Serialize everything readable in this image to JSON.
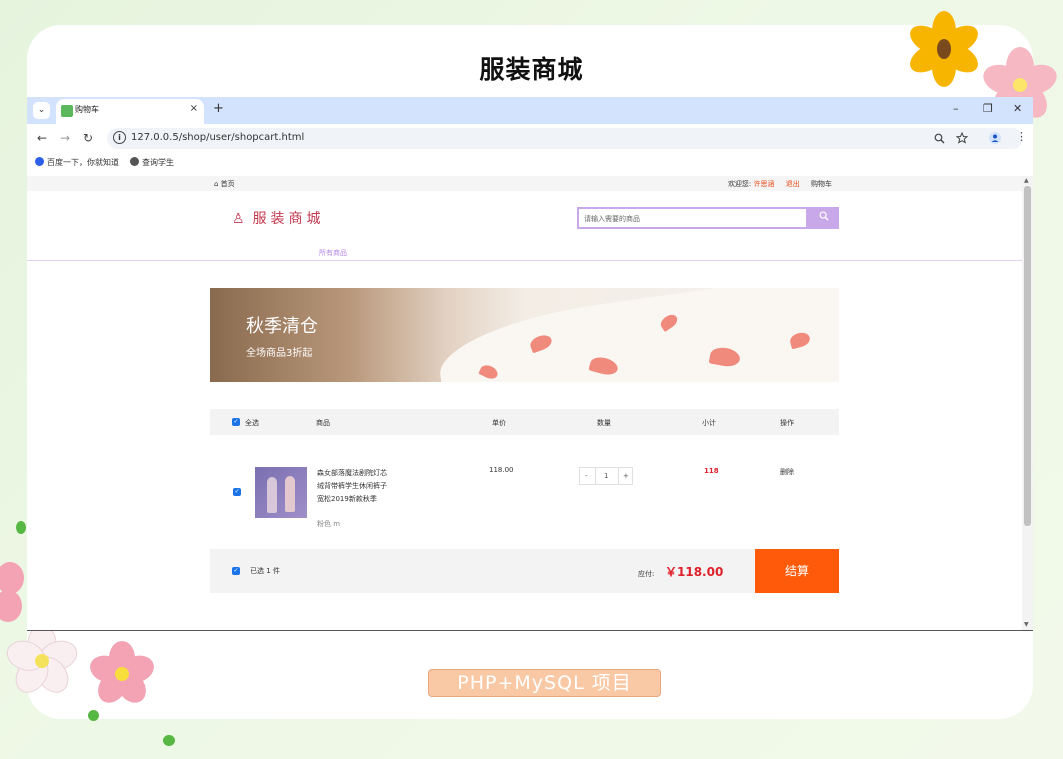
{
  "page_title": "服装商城",
  "footer_badge": "PHP+MySQL 项目",
  "browser": {
    "tab_title": "购物车",
    "tab_close": "×",
    "new_tab": "+",
    "url": "127.0.0.5/shop/user/shopcart.html",
    "window_controls": {
      "minimize": "–",
      "restore": "❐",
      "close": "✕"
    },
    "nav": {
      "back": "←",
      "forward": "→",
      "reload": "↻"
    },
    "bookmarks": [
      {
        "label": "百度一下，你就知道",
        "icon": "baidu-paw-icon",
        "color": "#2c5ee8"
      },
      {
        "label": "查询学生",
        "icon": "globe-icon",
        "color": "#555555"
      }
    ]
  },
  "site": {
    "topbar": {
      "home": "首页",
      "welcome": "欢迎您:",
      "username": "许思涵",
      "logout": "退出",
      "cart": "购物车"
    },
    "logo": "服装商城",
    "search_placeholder": "请输入需要的商品",
    "nav_all": "所有商品",
    "banner": {
      "title": "秋季清仓",
      "subtitle": "全场商品3折起"
    },
    "cart": {
      "headers": {
        "select_all": "全选",
        "product": "商品",
        "unit_price": "单价",
        "quantity": "数量",
        "subtotal": "小计",
        "action": "操作"
      },
      "items": [
        {
          "name": "森女部落魔法剧院灯芯绒背带裤学生休闲裤子宽松2019新款秋季",
          "spec": "粉色 m",
          "price": "118.00",
          "quantity": "1",
          "minus": "-",
          "plus": "+",
          "subtotal": "118",
          "action": "删除",
          "checked": true
        }
      ],
      "footer": {
        "selected": "已选 1 件",
        "payable_label": "应付:",
        "total": "￥118.00",
        "checkout": "结算"
      }
    }
  },
  "colors": {
    "accent_purple": "#c8a8e9",
    "checkout_orange": "#ff5a0a",
    "price_red": "#e0202c",
    "logo_red": "#c2384f"
  }
}
